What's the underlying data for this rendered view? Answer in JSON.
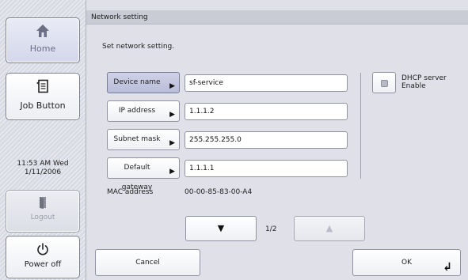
{
  "sidebar": {
    "home_label": "Home",
    "job_label": "Job Button",
    "clock_time": "11:53 AM  Wed",
    "clock_date": "1/11/2006",
    "logout_label": "Logout",
    "power_label": "Power off"
  },
  "window": {
    "title": "Network setting",
    "instruction": "Set network setting."
  },
  "fields": [
    {
      "label": "Device name",
      "value": "sf-service",
      "selected": true
    },
    {
      "label": "IP address",
      "value": "1.1.1.2",
      "selected": false
    },
    {
      "label": "Subnet mask",
      "value": "255.255.255.0",
      "selected": false
    },
    {
      "label": "Default gateway",
      "value": "1.1.1.1",
      "selected": false
    }
  ],
  "mac": {
    "label": "MAC address",
    "value": "00-00-85-83-00-A4"
  },
  "dhcp": {
    "line1": "DHCP server",
    "line2": "Enable",
    "enabled": false
  },
  "pager": {
    "indicator": "1/2",
    "down_icon": "triangle-down-icon",
    "up_icon": "triangle-up-icon"
  },
  "footer": {
    "cancel_label": "Cancel",
    "ok_label": "OK"
  },
  "colors": {
    "selected_button": "#c4c7e2",
    "panel_bg": "#dfe0e8",
    "sidebar_bg": "#d9dbe4"
  }
}
